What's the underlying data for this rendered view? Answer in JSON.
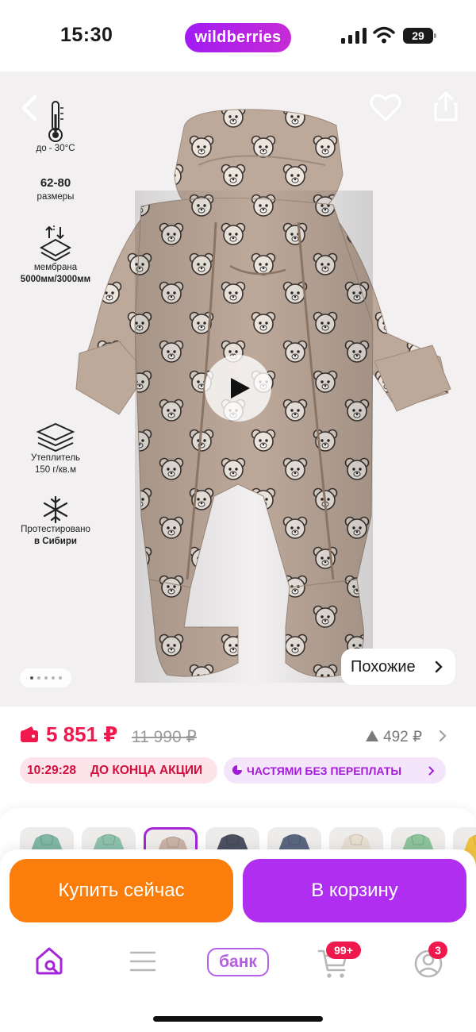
{
  "status_bar": {
    "time": "15:30",
    "brand": "wildberries",
    "battery": "29",
    "battery_level": 0.29
  },
  "features": [
    {
      "icon": "thermometer-icon",
      "label": "до - 30°C"
    },
    {
      "icon": "",
      "title": "62-80",
      "label": "размеры"
    },
    {
      "icon": "membrane-icon",
      "label": "мембрана",
      "label2": "5000мм/3000мм"
    },
    {
      "icon": "insulation-layers-icon",
      "label": "Утеплитель",
      "label2": "150 г/кв.м"
    },
    {
      "icon": "snowflake-icon",
      "label": "Протестировано",
      "label2": "в Сибири"
    }
  ],
  "gallery": {
    "current_index": 1,
    "total": 5,
    "similar_label": "Похожие"
  },
  "price": {
    "current": "5 851 ₽",
    "old": "11 990 ₽",
    "rating_value": "492 ₽",
    "timer": "10:29:28",
    "timer_label": "ДО КОНЦА АКЦИИ",
    "installment_label": "ЧАСТЯМИ БЕЗ ПЕРЕПЛАТЫ"
  },
  "colors": {
    "accent": "#b02ef0",
    "buy_now": "#fb7d0b",
    "price": "#f0194d",
    "thumbs": [
      "#7fb6a4",
      "#8dc0ad",
      "#c9b2a6",
      "#4b5060",
      "#5a6680",
      "#e7ded1",
      "#8dc49c",
      "#f0c241"
    ]
  },
  "actions": {
    "buy_now": "Купить сейчас",
    "to_cart": "В корзину"
  },
  "tabbar": {
    "items": [
      {
        "name": "home-search-icon"
      },
      {
        "name": "catalog-icon"
      },
      {
        "name": "bank",
        "label": "банк"
      },
      {
        "name": "cart-icon",
        "badge": "99+"
      },
      {
        "name": "profile-icon",
        "badge": "3"
      }
    ]
  }
}
